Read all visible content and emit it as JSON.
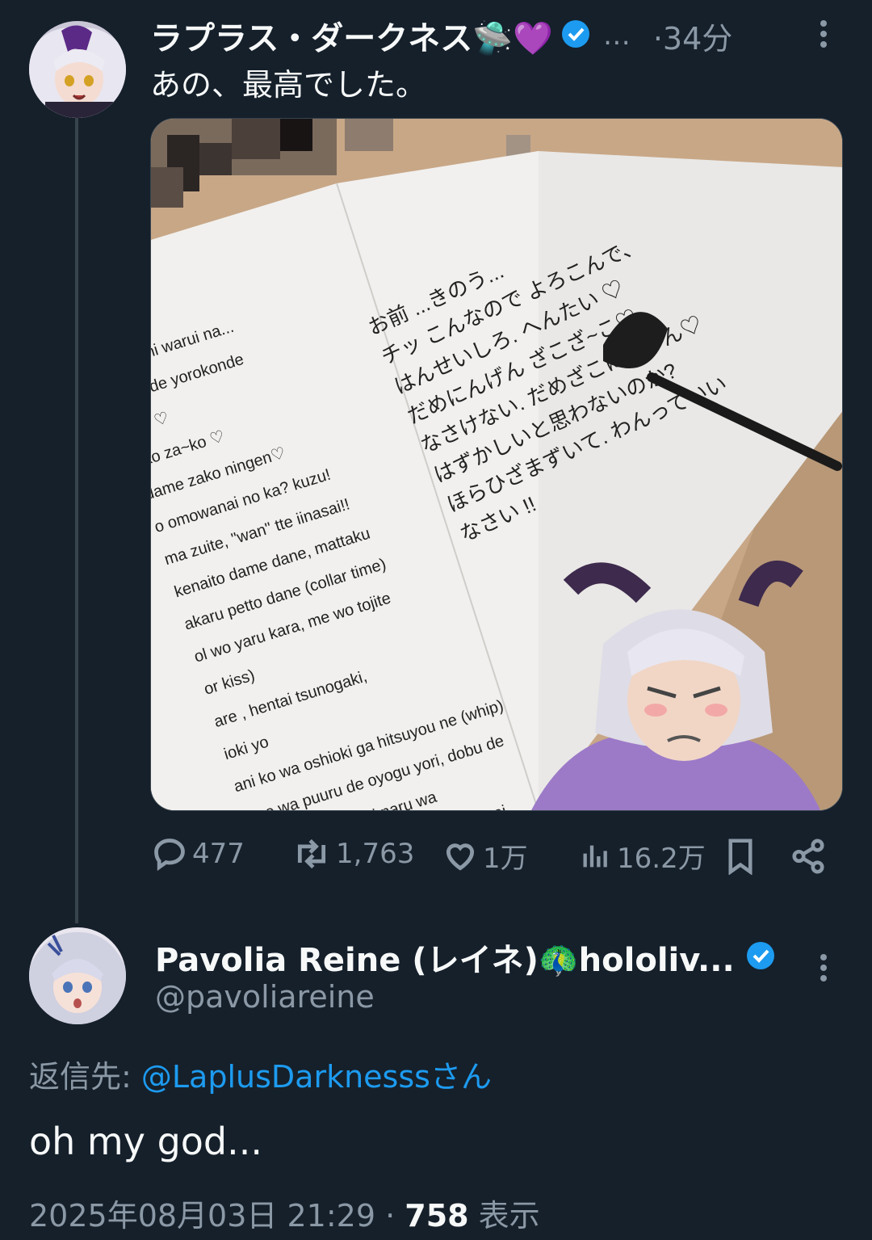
{
  "tweet1": {
    "display_name": "ラプラス・ダークネス🛸💜",
    "truncation": "…",
    "time": "·34分",
    "text": "あの、最高でした。",
    "stats": {
      "replies": "477",
      "retweets": "1,763",
      "likes": "1万",
      "views": "16.2万"
    },
    "media": {
      "left_page_lines": [
        "kimochi warui na...",
        "a no de yorokonde",
        "ntai ♡",
        "ako za~ko ♡",
        "dame zako ningen♡",
        "o omowanai no ka? kuzu!",
        "ma zuite, \"wan\" tte iinasai!!",
        "kenaito dame dane, mattaku",
        "akaru petto dane (collar time)",
        "ol wo yaru kara, me wo tojite",
        "or kiss)",
        "are , hentai tsunogaki,",
        "ioki yo",
        "ani ko wa oshioki ga hitsuyou ne (whip)",
        "mae wa puuru de oyogu yori, dobu de",
        "oyogu hou ga e ni naru wa",
        "mou okotteimasu wa. ayamarinasai"
      ],
      "right_page_lines": [
        "お前 ...きのう...",
        "チッ こんなので よろこんで、",
        "はんせいしろ. へんたい ♡",
        "だめにんげん ざこざ~こ♡",
        "なさけない. だめざこにんげん♡",
        "はずかしいと思わないのか?",
        "ほらひざまずいて. わんっていい",
        "なさい !!"
      ]
    }
  },
  "tweet2": {
    "display_name": "Pavolia Reine (レイネ)🦚hololiv...",
    "handle": "@pavoliareine",
    "reply_prefix": "返信先: ",
    "reply_to": "@LaplusDarknesssさん",
    "text": "oh my god...",
    "timestamp": "2025年08月03日 21:29 · ",
    "view_count": "758",
    "view_label": " 表示"
  },
  "colors": {
    "background": "#15202b",
    "accent": "#1d9bf0",
    "muted": "#8b98a5",
    "line": "#38444d"
  },
  "icons": [
    "verified-badge-icon",
    "more-icon",
    "reply-icon",
    "retweet-icon",
    "like-icon",
    "views-icon",
    "bookmark-icon",
    "share-icon"
  ]
}
